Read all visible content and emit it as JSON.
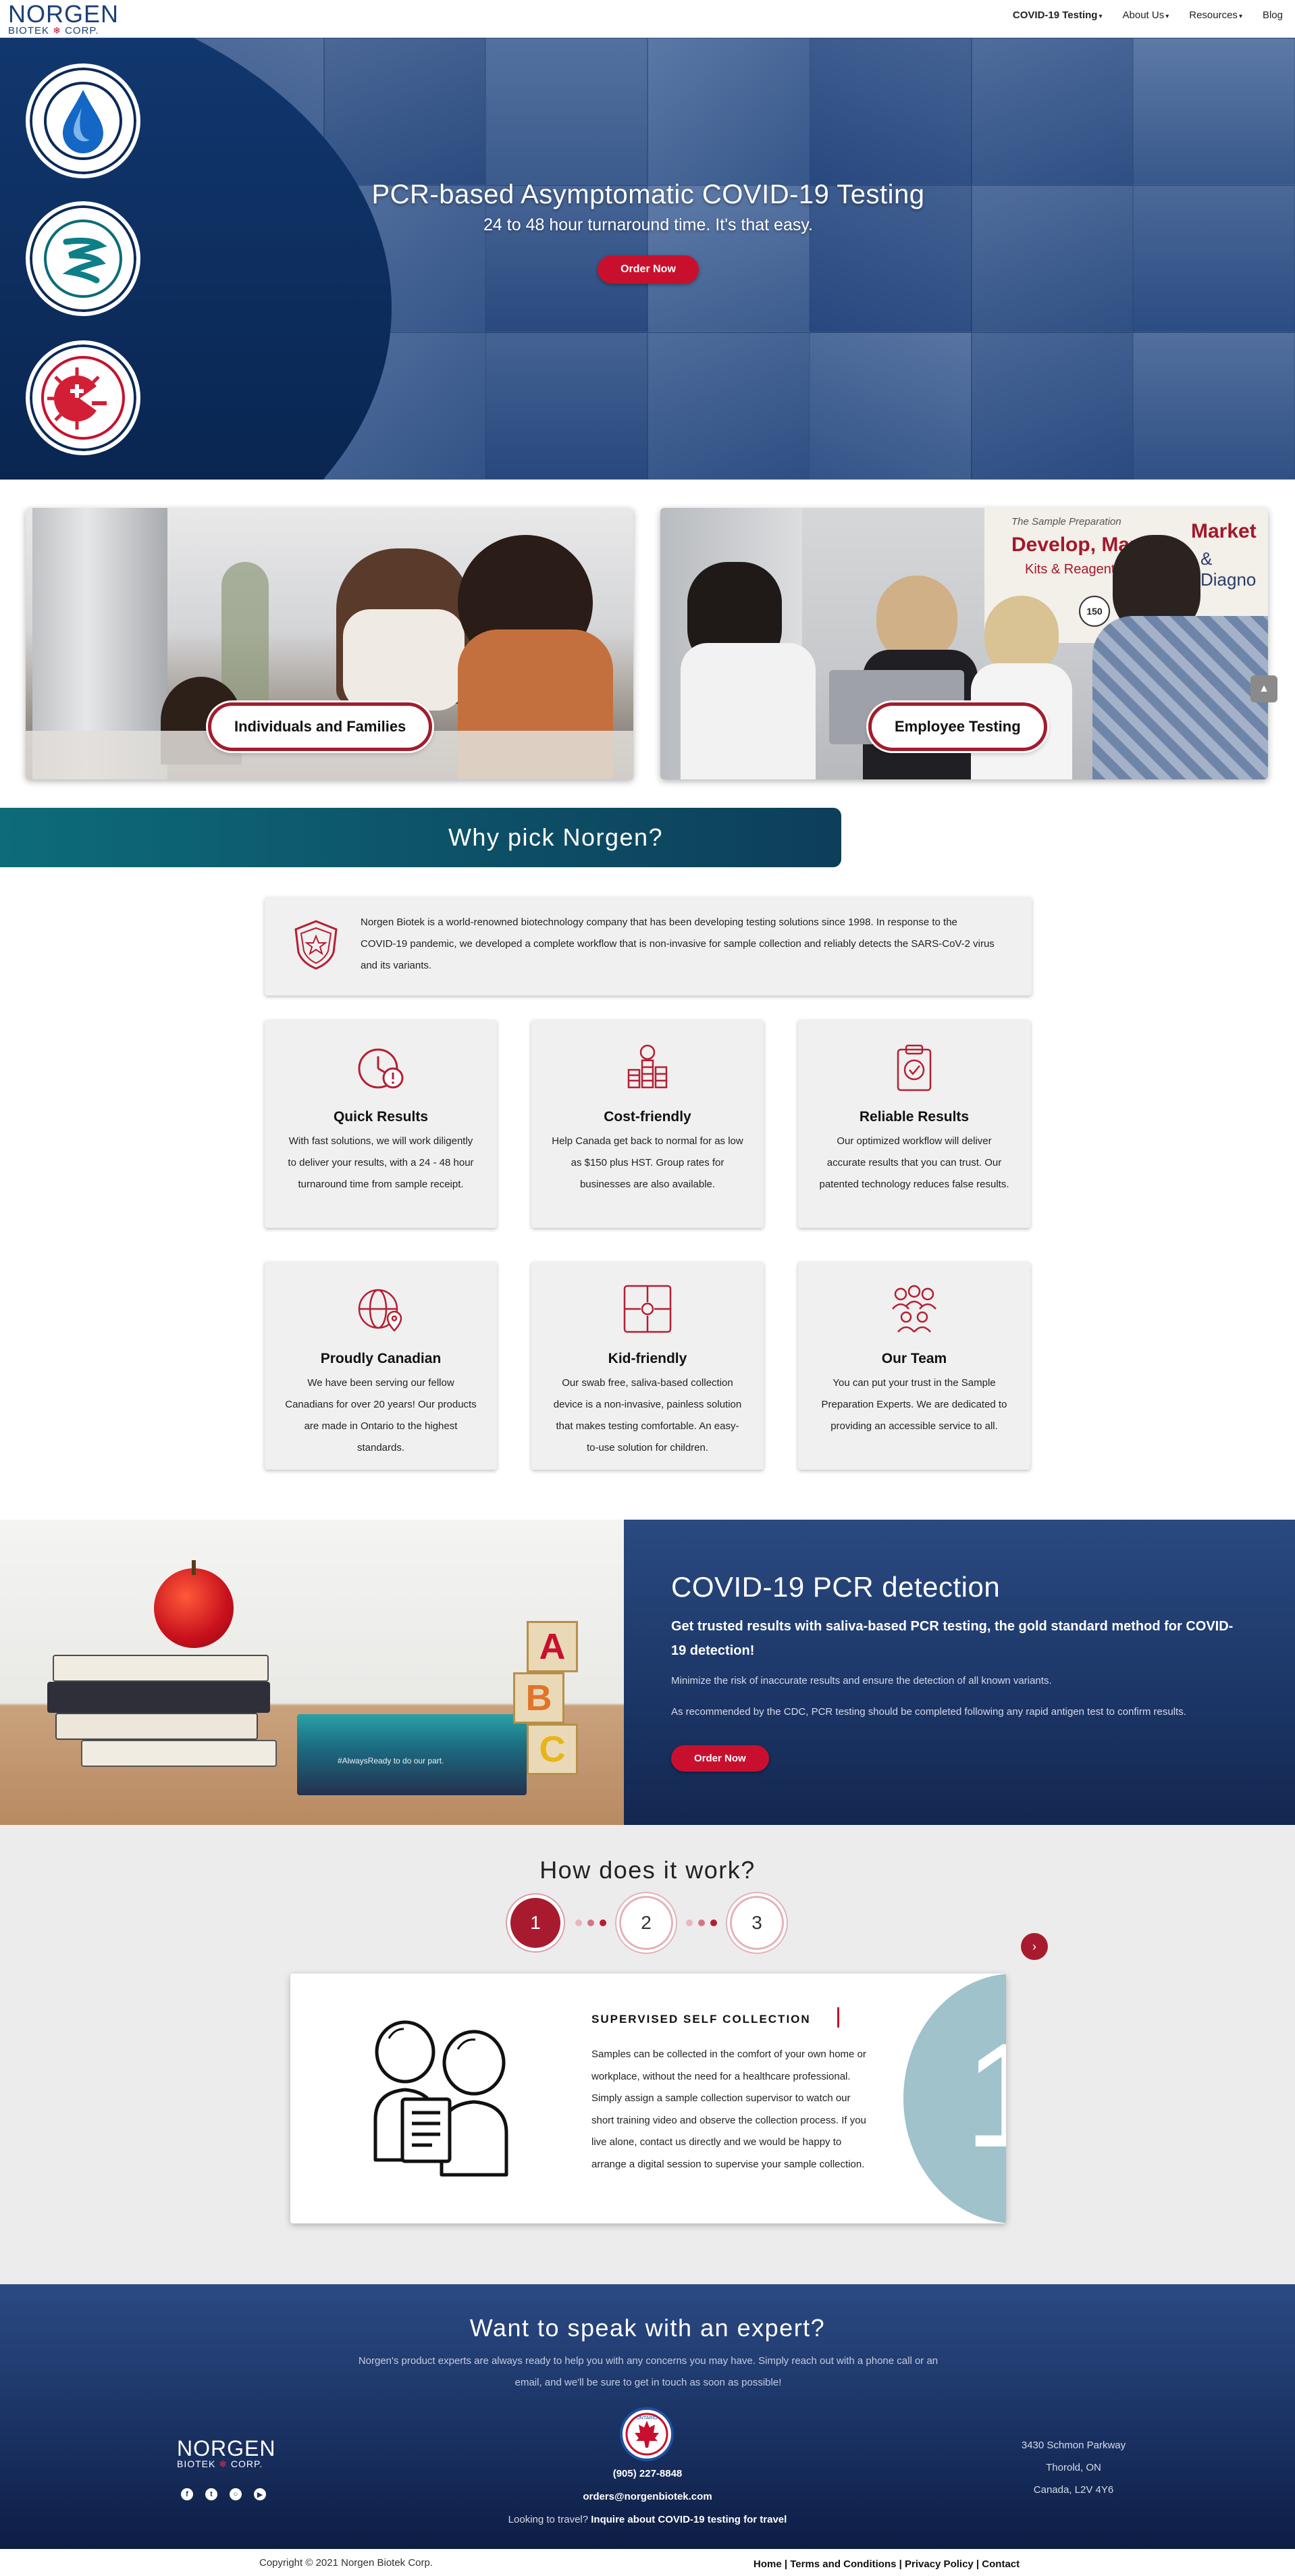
{
  "brand": {
    "name": "NORGEN",
    "sub_left": "BIOTEK",
    "sub_right": "CORP."
  },
  "nav": {
    "items": [
      {
        "label": "COVID-19 Testing",
        "caret": true,
        "active": true
      },
      {
        "label": "About Us",
        "caret": true,
        "active": false
      },
      {
        "label": "Resources",
        "caret": true,
        "active": false
      },
      {
        "label": "Blog",
        "caret": false,
        "active": false
      }
    ]
  },
  "hero": {
    "title": "PCR-based Asymptomatic COVID-19 Testing",
    "subtitle": "24 to 48 hour turnaround time. It's that easy.",
    "button": "Order Now",
    "icons": [
      "water-drop-icon",
      "dna-spiral-icon",
      "virus-test-icon"
    ]
  },
  "cards": [
    {
      "label": "Individuals and Families"
    },
    {
      "label": "Employee Testing"
    }
  ],
  "card_scene_text": {
    "sign_line1": "Develop, Manufa",
    "sign_market": "Market",
    "sign_line2": "Kits & Reagents",
    "sign_line3": "& Diagno",
    "sign_top": "The Sample Preparation",
    "iso": "150"
  },
  "why": {
    "title": "Why pick Norgen?",
    "intro": "Norgen Biotek is a world-renowned biotechnology company that has been developing testing solutions since 1998. In response to the COVID-19 pandemic, we developed a complete workflow that is non-invasive for sample collection and reliably detects the SARS-CoV-2 virus and its variants.",
    "features": [
      {
        "title": "Quick Results",
        "text": "With fast solutions, we will work diligently to deliver your results, with a 24 - 48 hour turnaround time from sample receipt.",
        "icon": "clock-icon"
      },
      {
        "title": "Cost-friendly",
        "text": "Help Canada get back to normal for as low as $150 plus HST. Group rates for businesses are also available.",
        "icon": "coins-icon"
      },
      {
        "title": "Reliable Results",
        "text": "Our optimized workflow will deliver accurate results that you can trust. Our patented technology reduces false results.",
        "icon": "clipboard-check-icon"
      },
      {
        "title": "Proudly Canadian",
        "text": "We have been serving our fellow Canadians for over 20 years! Our products are made in Ontario to the highest standards.",
        "icon": "globe-pin-icon"
      },
      {
        "title": "Kid-friendly",
        "text": "Our swab free, saliva-based collection device is a non-invasive, painless solution that makes testing comfortable. An easy-to-use solution for children.",
        "icon": "puzzle-icon"
      },
      {
        "title": "Our Team",
        "text": "You can put your trust in the Sample Preparation Experts. We are dedicated to providing an accessible service to all.",
        "icon": "team-icon"
      }
    ]
  },
  "pcr": {
    "title": "COVID-19 PCR detection",
    "lead": "Get trusted results with saliva-based PCR testing, the gold standard method for COVID-19 detection!",
    "p1": "Minimize the risk of inaccurate results and ensure the detection of all known variants.",
    "p2": "As recommended by the CDC, PCR testing should be completed following any rapid antigen test to confirm results.",
    "button": "Order Now",
    "box_text": "#AlwaysReady to do our part.",
    "blocks": [
      "A",
      "B",
      "C"
    ]
  },
  "how": {
    "title": "How does it work?",
    "steps": [
      "1",
      "2",
      "3"
    ],
    "active_step": 1,
    "card": {
      "heading": "SUPERVISED SELF COLLECTION",
      "text": "Samples can be collected in the comfort of your own home or workplace, without the need for a healthcare professional. Simply assign a sample collection supervisor to watch our short training video and observe the collection process. If you live alone, contact us directly and we would be happy to arrange a digital session to supervise your sample collection.",
      "number": "1"
    }
  },
  "contact": {
    "title": "Want to speak with an expert?",
    "desc": "Norgen's product experts are always ready to help you with any concerns you may have. Simply reach out with a phone call or an email, and we'll be sure to get in touch as soon as possible!",
    "phone": "(905) 227-8848",
    "email": "orders@norgenbiotek.com",
    "travel_prefix": "Looking to travel?",
    "travel_link": "Inquire about COVID-19 testing for travel",
    "address": [
      "3430 Schmon Parkway",
      "Thorold, ON",
      "Canada, L2V 4Y6"
    ],
    "badge": "ONTARIO"
  },
  "footer": {
    "copyright": "Copyright © 2021 Norgen Biotek Corp.",
    "links": [
      "Home",
      "Terms and Conditions",
      "Privacy Policy",
      "Contact"
    ]
  },
  "colors": {
    "brand_blue": "#1c3f78",
    "accent_red": "#c8102e",
    "teal": "#0d6c78",
    "navy": "#1a3263"
  }
}
